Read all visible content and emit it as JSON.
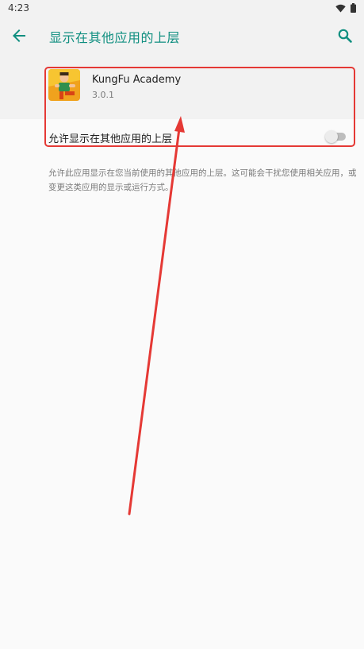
{
  "status_bar": {
    "time": "4:23"
  },
  "toolbar": {
    "title": "显示在其他应用的上层"
  },
  "app": {
    "name": "KungFu Academy",
    "version": "3.0.1"
  },
  "setting": {
    "label": "允许显示在其他应用的上层",
    "enabled": false
  },
  "description": "允许此应用显示在您当前使用的其他应用的上层。这可能会干扰您使用相关应用，或变更这类应用的显示或运行方式。",
  "colors": {
    "accent": "#108f80",
    "annotation": "#e53935"
  },
  "icons": {
    "back": "arrow-back-icon",
    "search": "search-icon",
    "wifi": "wifi-icon",
    "battery": "battery-icon"
  }
}
